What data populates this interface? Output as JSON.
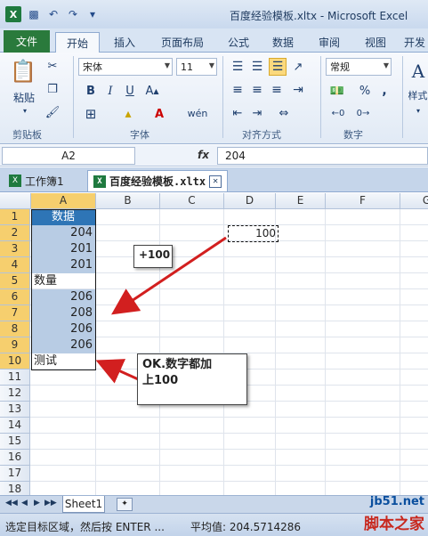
{
  "window": {
    "title": "百度经验模板.xltx - Microsoft Excel",
    "logo": "X"
  },
  "ribbon_tabs": [
    "文件",
    "开始",
    "插入",
    "页面布局",
    "公式",
    "数据",
    "审阅",
    "视图",
    "开发"
  ],
  "ribbon": {
    "paste_label": "粘贴",
    "clipboard_group": "剪贴板",
    "font_name": "宋体",
    "font_size": "11",
    "bold": "B",
    "italic": "I",
    "underline": "U",
    "font_group": "字体",
    "alignment_group": "对齐方式",
    "number_format": "常规",
    "percent": "%",
    "comma": ",",
    "number_group": "数字",
    "styles_label": "样式",
    "styles_glyph": "A",
    "font_color_glyph": "A",
    "grow_font_glyph": "A",
    "phonetic_glyph": "wén"
  },
  "formula_bar": {
    "name_box": "A2",
    "fx": "fx",
    "value": "204"
  },
  "doc_tabs": [
    {
      "label": "工作簿1",
      "active": false
    },
    {
      "label": "百度经验模板.xltx",
      "active": true
    }
  ],
  "close_glyph": "✕",
  "columns": [
    "A",
    "B",
    "C",
    "D",
    "E",
    "F",
    "G"
  ],
  "rows": [
    "1",
    "2",
    "3",
    "4",
    "5",
    "6",
    "7",
    "8",
    "9",
    "10",
    "11",
    "12",
    "13",
    "14",
    "15",
    "16",
    "17",
    "18"
  ],
  "cells": [
    {
      "text": "数据",
      "kind": "head"
    },
    {
      "text": "204",
      "kind": "num"
    },
    {
      "text": "201",
      "kind": "num"
    },
    {
      "text": "201",
      "kind": "num"
    },
    {
      "text": "数量",
      "kind": "txt"
    },
    {
      "text": "206",
      "kind": "num"
    },
    {
      "text": "208",
      "kind": "num"
    },
    {
      "text": "206",
      "kind": "num"
    },
    {
      "text": "206",
      "kind": "num"
    },
    {
      "text": "测试",
      "kind": "txt"
    }
  ],
  "copied_cell": "100",
  "callouts": {
    "plus": "+100",
    "ok_line1": "OK.数字都加",
    "ok_line2": "上100"
  },
  "sheet_tabs": [
    "Sheet1"
  ],
  "status": {
    "message": "选定目标区域，然后按 ENTER ...",
    "average": "平均值: 204.5714286"
  },
  "watermark": {
    "line1": "jb51.net",
    "line2": "脚本之家"
  },
  "colors": {
    "header_fill": "#2e75b6",
    "data_fill": "#b8cce4",
    "arrow": "#d21f1f",
    "file_tab": "#2a7a3c"
  }
}
